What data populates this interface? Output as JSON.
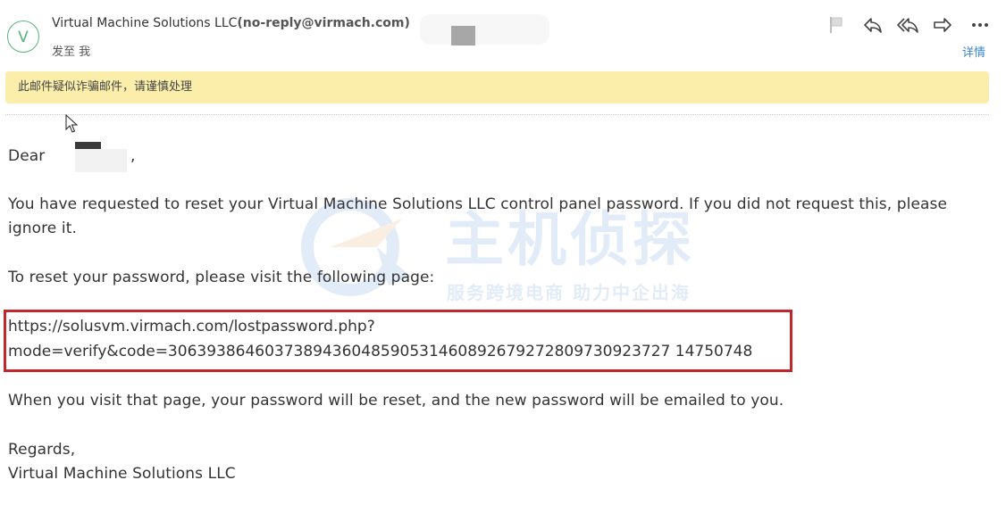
{
  "header": {
    "avatar_letter": "V",
    "sender_name": "Virtual Machine Solutions LLC",
    "sender_email": "(no-reply@virmach.com)",
    "sent_to": "发至 我",
    "details_label": "详情",
    "toolbar": [
      {
        "name": "flag-icon"
      },
      {
        "name": "reply-icon"
      },
      {
        "name": "reply-all-icon"
      },
      {
        "name": "forward-icon"
      },
      {
        "name": "more-icon"
      }
    ]
  },
  "warning": {
    "text": "此邮件疑似诈骗邮件，请谨慎处理",
    "background": "#fbeeaa"
  },
  "email_body": {
    "greeting": "Dear",
    "greeting_suffix": ",",
    "paragraph1_line1": "You have requested to reset your Virtual Machine Solutions LLC control panel password. If you did not request this, please",
    "paragraph1_line2": "ignore it.",
    "paragraph2": "To reset your password, please visit the following page:",
    "link_line1": "https://solusvm.virmach.com/lostpassword.php?",
    "link_line2": "mode=verify&code=3063938646037389436048590531460892679272809730923727 14750748",
    "paragraph3": "When you visit that page, your password will be reset, and the new password will be emailed to you.",
    "regards": "Regards,",
    "signature": "Virtual Machine Solutions LLC"
  },
  "watermark": {
    "title": "主机侦探",
    "subtitle": "服务跨境电商 助力中企出海"
  },
  "colors": {
    "accent_link": "#3a86d0",
    "avatar": "#55b57c",
    "highlight_box": "#c0272d"
  }
}
